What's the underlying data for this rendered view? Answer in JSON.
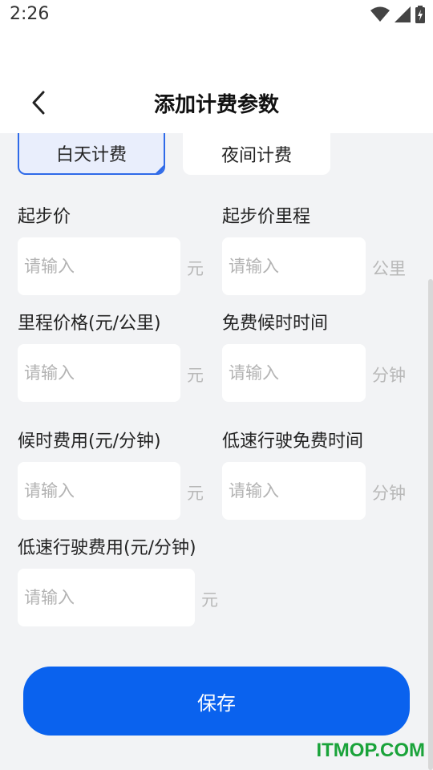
{
  "status_bar": {
    "time": "2:26"
  },
  "header": {
    "title": "添加计费参数"
  },
  "tabs": [
    {
      "label": "白天计费",
      "selected": true
    },
    {
      "label": "夜间计费",
      "selected": false
    }
  ],
  "fields": {
    "start_price": {
      "label": "起步价",
      "placeholder": "请输入",
      "unit": "元"
    },
    "start_mileage": {
      "label": "起步价里程",
      "placeholder": "请输入",
      "unit": "公里"
    },
    "mileage_price": {
      "label": "里程价格(元/公里)",
      "placeholder": "请输入",
      "unit": "元"
    },
    "free_wait_time": {
      "label": "免费候时时间",
      "placeholder": "请输入",
      "unit": "分钟"
    },
    "wait_fee": {
      "label": "候时费用(元/分钟)",
      "placeholder": "请输入",
      "unit": "元"
    },
    "low_speed_free_time": {
      "label": "低速行驶免费时间",
      "placeholder": "请输入",
      "unit": "分钟"
    },
    "low_speed_fee": {
      "label": "低速行驶费用(元/分钟)",
      "placeholder": "请输入",
      "unit": "元"
    }
  },
  "save_label": "保存",
  "watermark": "ITMOP.COM",
  "colors": {
    "accent": "#0a62ee",
    "tab_selected_bg": "#e9eefc",
    "background": "#f2f3f5"
  },
  "icons": {
    "back": "chevron-left-icon",
    "wifi": "wifi-icon",
    "signal": "signal-icon",
    "battery": "battery-icon"
  }
}
